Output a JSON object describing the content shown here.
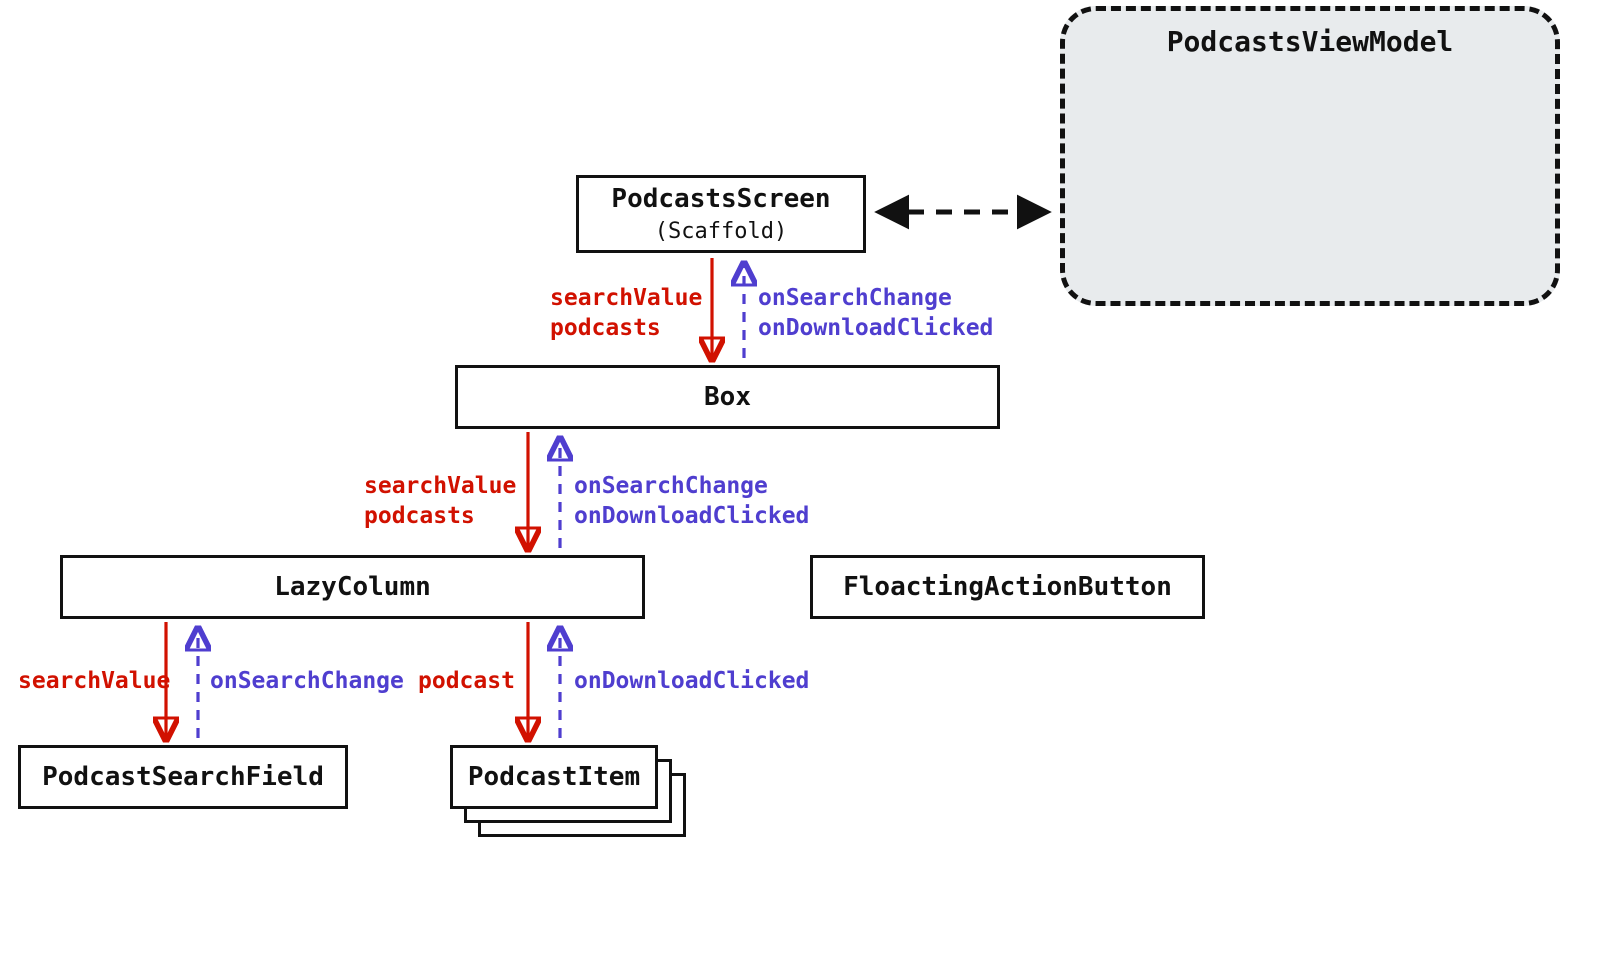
{
  "nodes": {
    "podcastsScreen": {
      "title": "PodcastsScreen",
      "subtitle": "(Scaffold)"
    },
    "box": {
      "title": "Box"
    },
    "lazyColumn": {
      "title": "LazyColumn"
    },
    "floatingActionButton": {
      "title": "FloactingActionButton"
    },
    "podcastSearchField": {
      "title": "PodcastSearchField"
    },
    "podcastItem": {
      "title": "PodcastItem"
    },
    "viewModel": {
      "title": "PodcastsViewModel"
    }
  },
  "edges": {
    "screenToBox": {
      "down": [
        "searchValue",
        "podcasts"
      ],
      "up": [
        "onSearchChange",
        "onDownloadClicked"
      ]
    },
    "boxToLazy": {
      "down": [
        "searchValue",
        "podcasts"
      ],
      "up": [
        "onSearchChange",
        "onDownloadClicked"
      ]
    },
    "lazyToSearchField": {
      "down": [
        "searchValue"
      ],
      "up": [
        "onSearchChange"
      ]
    },
    "lazyToPodcastItem": {
      "down": [
        "podcast"
      ],
      "up": [
        "onDownloadClicked"
      ]
    }
  },
  "colors": {
    "downArrow": "#d11100",
    "upArrow": "#4f3ecf",
    "boxBorder": "#111111",
    "vmFill": "#e8ebed"
  }
}
